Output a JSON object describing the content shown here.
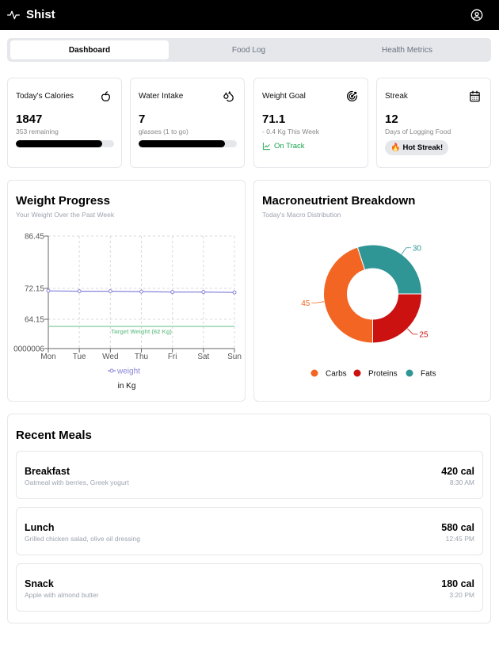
{
  "app": {
    "title": "Shist"
  },
  "tabs": [
    {
      "label": "Dashboard",
      "active": true
    },
    {
      "label": "Food Log",
      "active": false
    },
    {
      "label": "Health Metrics",
      "active": false
    }
  ],
  "stats": {
    "calories": {
      "title": "Today's Calories",
      "value": "1847",
      "sub": "353 remaining",
      "progress": 0.88,
      "icon": "apple-icon"
    },
    "water": {
      "title": "Water Intake",
      "value": "7",
      "sub": "glasses (1 to go)",
      "progress": 0.875,
      "icon": "droplets-icon"
    },
    "weight": {
      "title": "Weight Goal",
      "value": "71.1",
      "sub": "- 0.4 Kg This Week",
      "status": "On Track",
      "icon": "target-icon"
    },
    "streak": {
      "title": "Streak",
      "value": "12",
      "sub": "Days of Logging Food",
      "badge": "Hot Streak!",
      "icon": "calendar-icon"
    }
  },
  "weight_panel": {
    "title": "Weight Progress",
    "subtitle": "Your Weight Over the Past Week",
    "target_label": "Target Weight (62 Kg)",
    "legend_label": "weight",
    "unit_label": "in Kg"
  },
  "macro_panel": {
    "title": "Macroneutrient Breakdown",
    "subtitle": "Today's Macro Distribution"
  },
  "chart_data": [
    {
      "type": "line",
      "title": "Weight Progress",
      "categories": [
        "Mon",
        "Tue",
        "Wed",
        "Thu",
        "Fri",
        "Sat",
        "Sun"
      ],
      "series": [
        {
          "name": "weight",
          "values": [
            71.5,
            71.4,
            71.4,
            71.3,
            71.2,
            71.2,
            71.1
          ]
        }
      ],
      "y_ticks": [
        "86.45",
        "72.15",
        "64.15",
        "0000006"
      ],
      "ylim": [
        61,
        86.45
      ],
      "reference_line": {
        "value": 62,
        "label": "Target Weight (62 Kg)"
      },
      "grid": true,
      "legend": "bottom",
      "color": "#8884d8",
      "target_color": "#82ca9d"
    },
    {
      "type": "pie",
      "title": "Macroneutrient Breakdown",
      "categories": [
        "Carbs",
        "Proteins",
        "Fats"
      ],
      "values": [
        45,
        25,
        30
      ],
      "colors": [
        "#f26522",
        "#cc1111",
        "#2f9595"
      ],
      "legend": "bottom"
    }
  ],
  "meals_panel": {
    "title": "Recent Meals"
  },
  "meals": [
    {
      "name": "Breakfast",
      "desc": "Oatmeal with berries, Greek yogurt",
      "cal": "420 cal",
      "time": "8:30 AM"
    },
    {
      "name": "Lunch",
      "desc": "Grilled chicken salad, olive oil dressing",
      "cal": "580 cal",
      "time": "12:45 PM"
    },
    {
      "name": "Snack",
      "desc": "Apple with almond butter",
      "cal": "180 cal",
      "time": "3:20 PM"
    }
  ]
}
